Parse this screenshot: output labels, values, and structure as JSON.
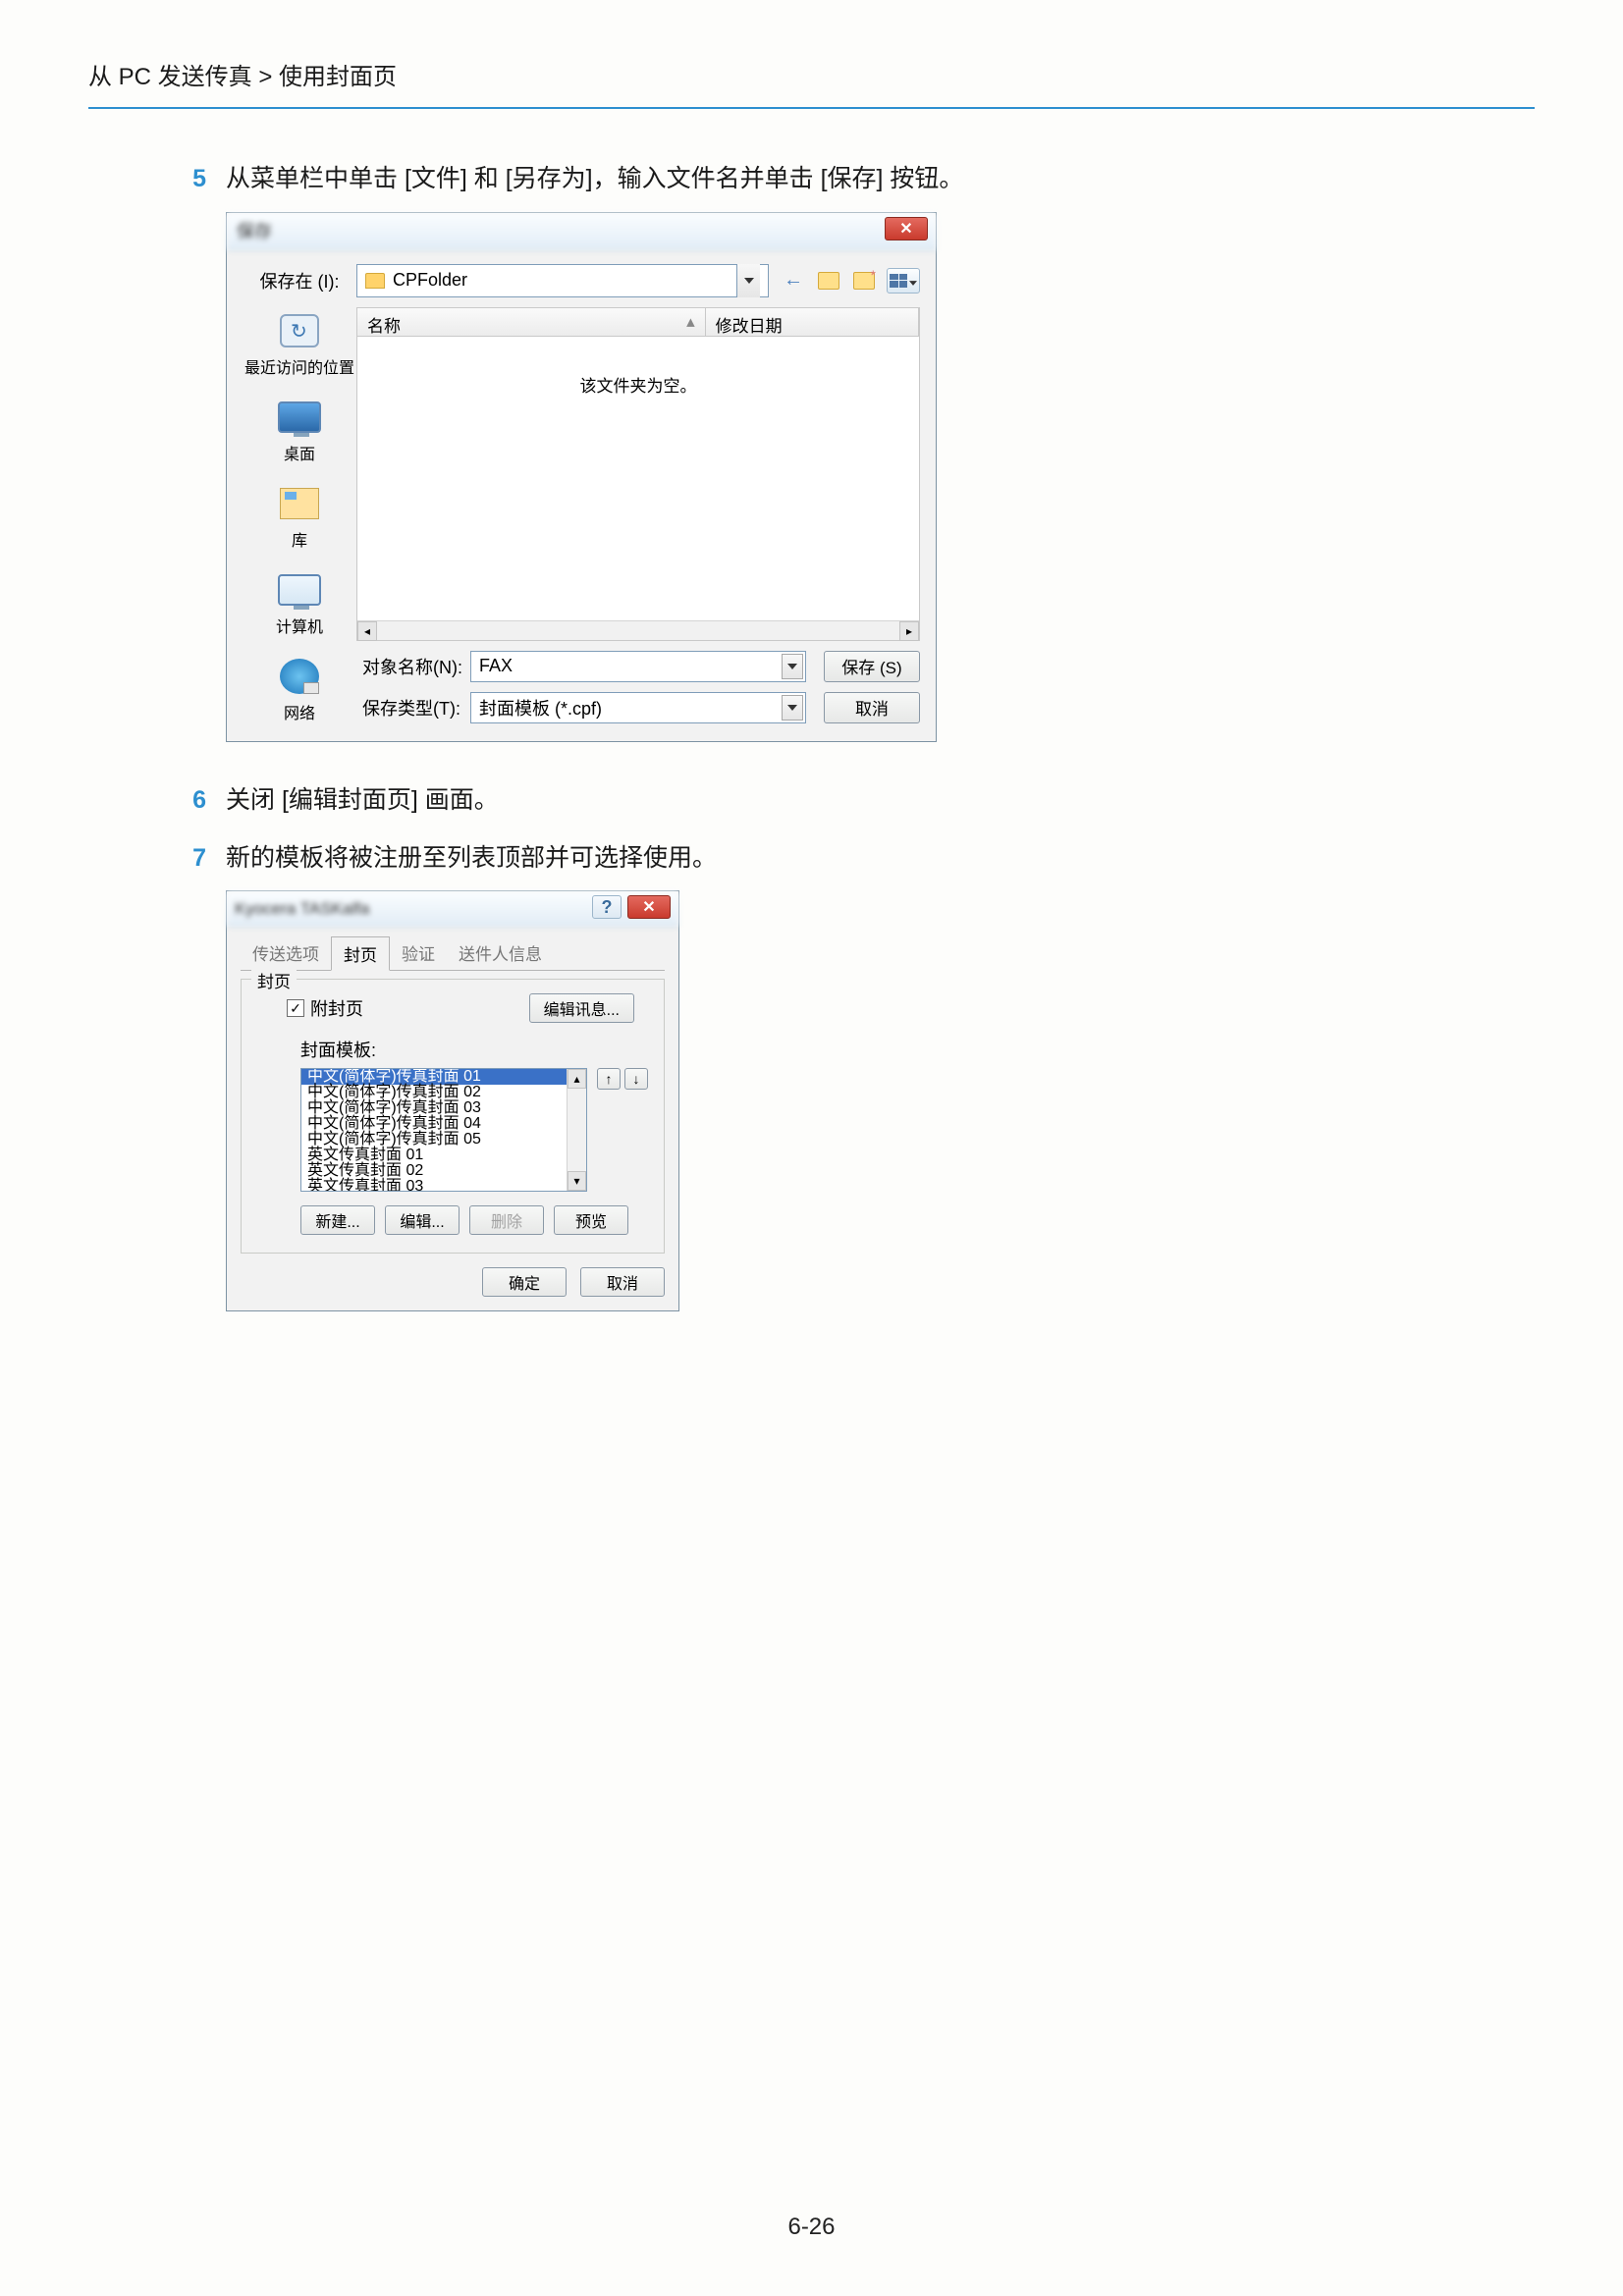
{
  "breadcrumb": "从 PC 发送传真 > 使用封面页",
  "step5": {
    "num": "5",
    "text": "从菜单栏中单击 [文件] 和 [另存为]，输入文件名并单击 [保存] 按钮。"
  },
  "step6": {
    "num": "6",
    "text": "关闭 [编辑封面页] 画面。"
  },
  "step7": {
    "num": "7",
    "text": "新的模板将被注册至列表顶部并可选择使用。"
  },
  "saveas": {
    "title": "保存",
    "close": "✕",
    "save_in_label": "保存在 (I):",
    "folder": "CPFolder",
    "col_name": "名称",
    "col_date": "修改日期",
    "empty_text": "该文件夹为空。",
    "sidebar": {
      "recent": "最近访问的位置",
      "desktop": "桌面",
      "library": "库",
      "computer": "计算机",
      "network": "网络"
    },
    "obj_name_label": "对象名称(N):",
    "obj_name_value": "FAX",
    "save_type_label": "保存类型(T):",
    "save_type_value": "封面模板 (*.cpf)",
    "btn_save": "保存 (S)",
    "btn_cancel": "取消"
  },
  "cover": {
    "title_blur": "Kyocera TASKalfa",
    "help": "?",
    "close": "✕",
    "tabs": {
      "t1": "传送选项",
      "t2": "封页",
      "t3": "验证",
      "t4": "送件人信息"
    },
    "group_title": "封页",
    "chk_label": "附封页",
    "btn_edit_msg": "编辑讯息...",
    "list_label": "封面模板:",
    "items": [
      "中文(简体字)传真封面 01",
      "中文(简体字)传真封面 02",
      "中文(简体字)传真封面 03",
      "中文(简体字)传真封面 04",
      "中文(简体字)传真封面 05",
      "英文传真封面 01",
      "英文传真封面 02",
      "英文传真封面 03"
    ],
    "btn_new": "新建...",
    "btn_edit": "编辑...",
    "btn_delete": "删除",
    "btn_preview": "预览",
    "btn_ok": "确定",
    "btn_cancel": "取消"
  },
  "page_number": "6-26"
}
